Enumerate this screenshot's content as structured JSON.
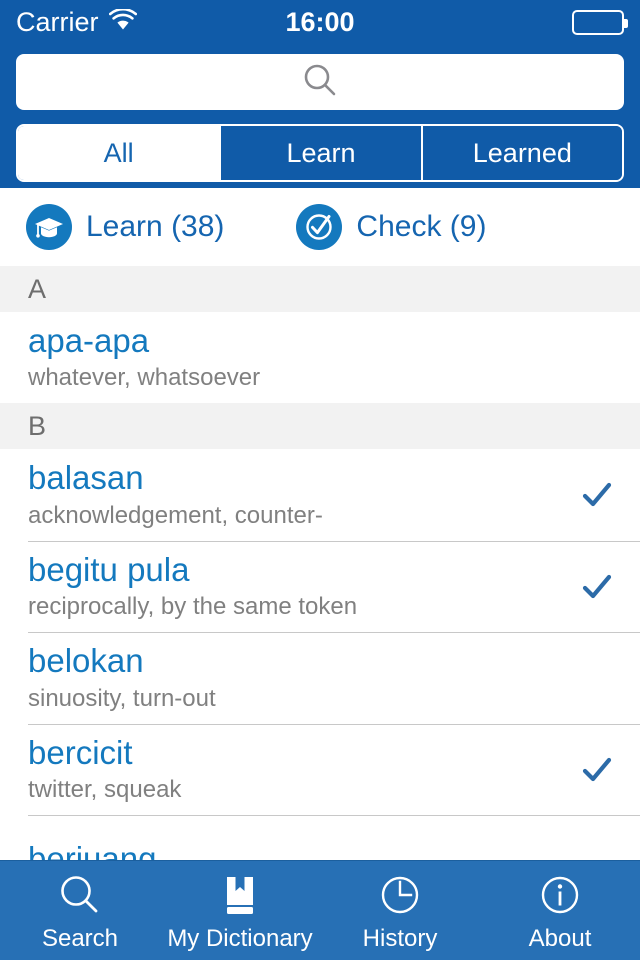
{
  "statusbar": {
    "carrier": "Carrier",
    "time": "16:00",
    "wifi_icon": "wifi-icon",
    "battery_icon": "battery-icon"
  },
  "search": {
    "value": "",
    "placeholder": "",
    "icon": "search-icon"
  },
  "segmented_control": {
    "selected": "All",
    "options": [
      {
        "label": "All",
        "active": true
      },
      {
        "label": "Learn",
        "active": false
      },
      {
        "label": "Learned",
        "active": false
      }
    ]
  },
  "actionbar": {
    "learn": {
      "label": "Learn (38)",
      "count": 38,
      "icon": "graduation-cap-icon"
    },
    "check": {
      "label": "Check (9)",
      "count": 9,
      "icon": "check-circle-icon"
    }
  },
  "list": {
    "sections": [
      {
        "letter": "A",
        "entries": [
          {
            "term": "apa-apa",
            "definition": "whatever, whatsoever",
            "learned": false
          }
        ]
      },
      {
        "letter": "B",
        "entries": [
          {
            "term": "balasan",
            "definition": "acknowledgement, counter-",
            "learned": true
          },
          {
            "term": "begitu pula",
            "definition": "reciprocally, by the same token",
            "learned": true
          },
          {
            "term": "belokan",
            "definition": "sinuosity, turn-out",
            "learned": false
          },
          {
            "term": "bercicit",
            "definition": "twitter, squeak",
            "learned": true
          },
          {
            "term": "berjuang",
            "definition": "",
            "learned": false
          }
        ]
      }
    ]
  },
  "tabbar": {
    "tabs": [
      {
        "label": "Search",
        "icon": "search-icon",
        "active": false
      },
      {
        "label": "My Dictionary",
        "icon": "book-icon",
        "active": true
      },
      {
        "label": "History",
        "icon": "clock-icon",
        "active": false
      },
      {
        "label": "About",
        "icon": "info-icon",
        "active": false
      }
    ]
  },
  "colors": {
    "header_blue": "#105BA8",
    "tabbar_blue": "#2770B5",
    "term_blue": "#1479BE",
    "check_blue": "#2C6BA8",
    "section_gray": "#F2F2F2",
    "definition_gray": "#808080"
  }
}
